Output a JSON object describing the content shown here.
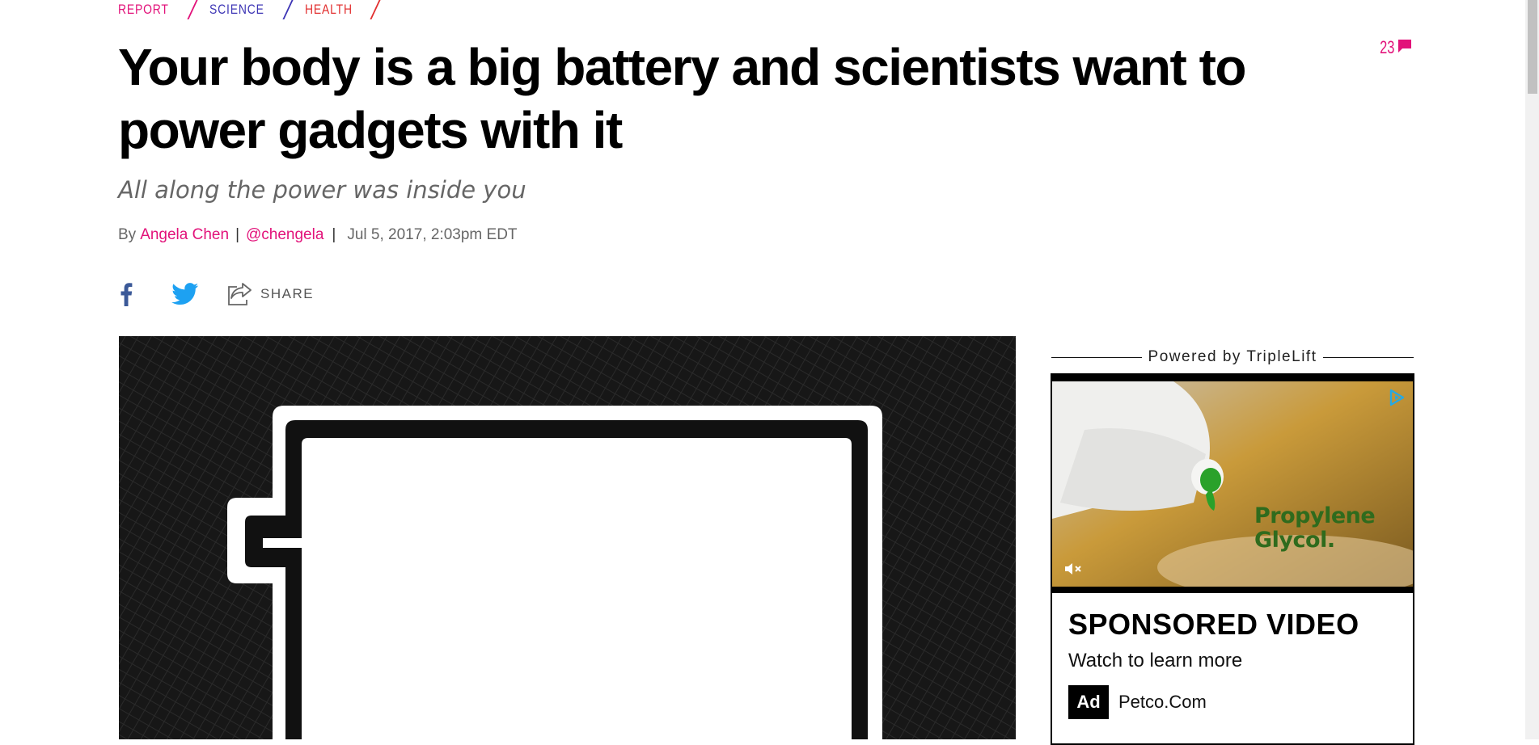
{
  "breadcrumbs": [
    {
      "label": "Report",
      "color": "#e2127a"
    },
    {
      "label": "Science",
      "color": "#3d35b5"
    },
    {
      "label": "Health",
      "color": "#e23030"
    }
  ],
  "article": {
    "title": "Your body is a big battery and scientists want to power gadgets with it",
    "subtitle": "All along the power was inside you",
    "byline_prefix": "By",
    "author": "Angela Chen",
    "handle": "@chengela",
    "sep": "|",
    "timestamp": "Jul 5, 2017, 2:03pm EDT"
  },
  "comments": {
    "count": "23",
    "icon": "comment-bubble-icon"
  },
  "share": {
    "facebook_icon": "facebook-icon",
    "twitter_icon": "twitter-icon",
    "share_icon": "share-icon",
    "label": "SHARE"
  },
  "sidebar": {
    "powered_by": "Powered by TripleLift",
    "ad": {
      "video_text_line1": "Propylene",
      "video_text_line2": "Glycol.",
      "headline": "SPONSORED VIDEO",
      "description": "Watch to learn more",
      "badge": "Ad",
      "advertiser": "Petco.Com"
    }
  },
  "colors": {
    "accent": "#e2127a",
    "facebook": "#3b5998",
    "twitter": "#1da1f2"
  }
}
